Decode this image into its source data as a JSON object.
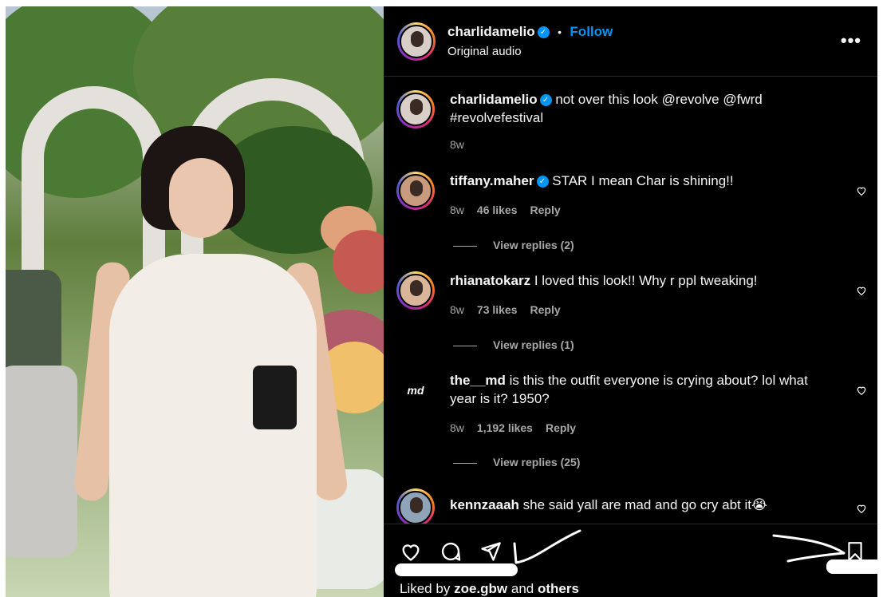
{
  "post": {
    "author": "charlidamelio",
    "separator": "•",
    "follow_label": "Follow",
    "audio": "Original audio",
    "more_icon": "more-horizontal-icon"
  },
  "caption": {
    "author": "charlidamelio",
    "text": "not over this look @revolve @fwrd #revolvefestival",
    "time": "8w"
  },
  "comments": [
    {
      "user": "tiffany.maher",
      "verified": true,
      "text": "STAR I mean Char is shining!!",
      "time": "8w",
      "likes": "46 likes",
      "reply": "Reply",
      "view_replies": "View replies (2)"
    },
    {
      "user": "rhianatokarz",
      "verified": false,
      "text": "I loved this look!! Why r ppl tweaking!",
      "time": "8w",
      "likes": "73 likes",
      "reply": "Reply",
      "view_replies": "View replies (1)"
    },
    {
      "user": "the__md",
      "verified": false,
      "avatar_text": "md",
      "text": "is this the outfit everyone is crying about? lol what year is it? 1950?",
      "time": "8w",
      "likes": "1,192 likes",
      "reply": "Reply",
      "view_replies": "View replies (25)"
    },
    {
      "user": "kennzaaah",
      "verified": false,
      "text": "she said yall are mad and go cry abt it😭"
    }
  ],
  "actions": {
    "icons": [
      "heart-icon",
      "comment-icon",
      "share-icon",
      "bookmark-icon"
    ]
  },
  "liked_by": {
    "prefix": "Liked by",
    "user": "zoe.gbw",
    "and": "and",
    "others": "others"
  },
  "colors": {
    "accent": "#0095f6",
    "panel_bg": "#000000",
    "muted": "#a8a8a8"
  }
}
